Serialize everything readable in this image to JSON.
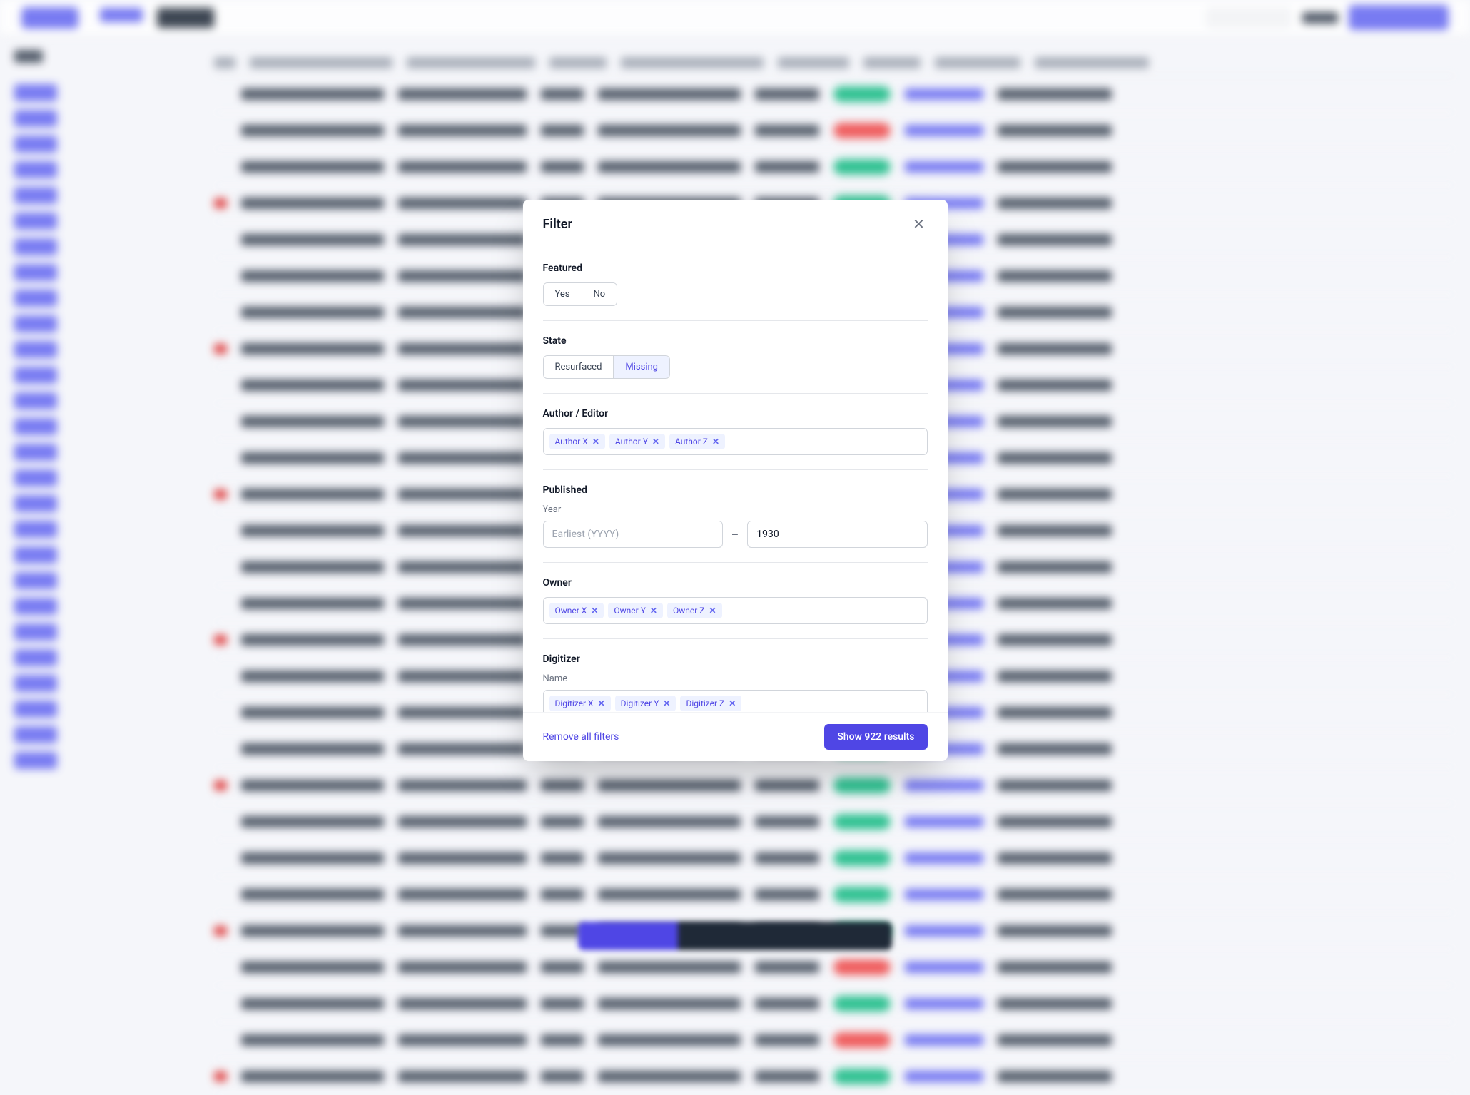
{
  "modal": {
    "title": "Filter",
    "sections": {
      "featured": {
        "label": "Featured",
        "options": [
          "Yes",
          "No"
        ]
      },
      "state": {
        "label": "State",
        "options": [
          "Resurfaced",
          "Missing"
        ],
        "active_index": 1
      },
      "author_editor": {
        "label": "Author / Editor",
        "tags": [
          "Author X",
          "Author Y",
          "Author Z"
        ]
      },
      "published": {
        "label": "Published",
        "sub_label": "Year",
        "from_placeholder": "Earliest (YYYY)",
        "from_value": "",
        "to_value": "1930",
        "dash": "–"
      },
      "owner": {
        "label": "Owner",
        "tags": [
          "Owner X",
          "Owner Y",
          "Owner Z"
        ]
      },
      "digitizer": {
        "label": "Digitizer",
        "sub_label": "Name",
        "tags": [
          "Digitizer X",
          "Digitizer Y",
          "Digitizer Z"
        ]
      }
    },
    "footer": {
      "remove_label": "Remove all filters",
      "show_label": "Show 922 results"
    }
  }
}
